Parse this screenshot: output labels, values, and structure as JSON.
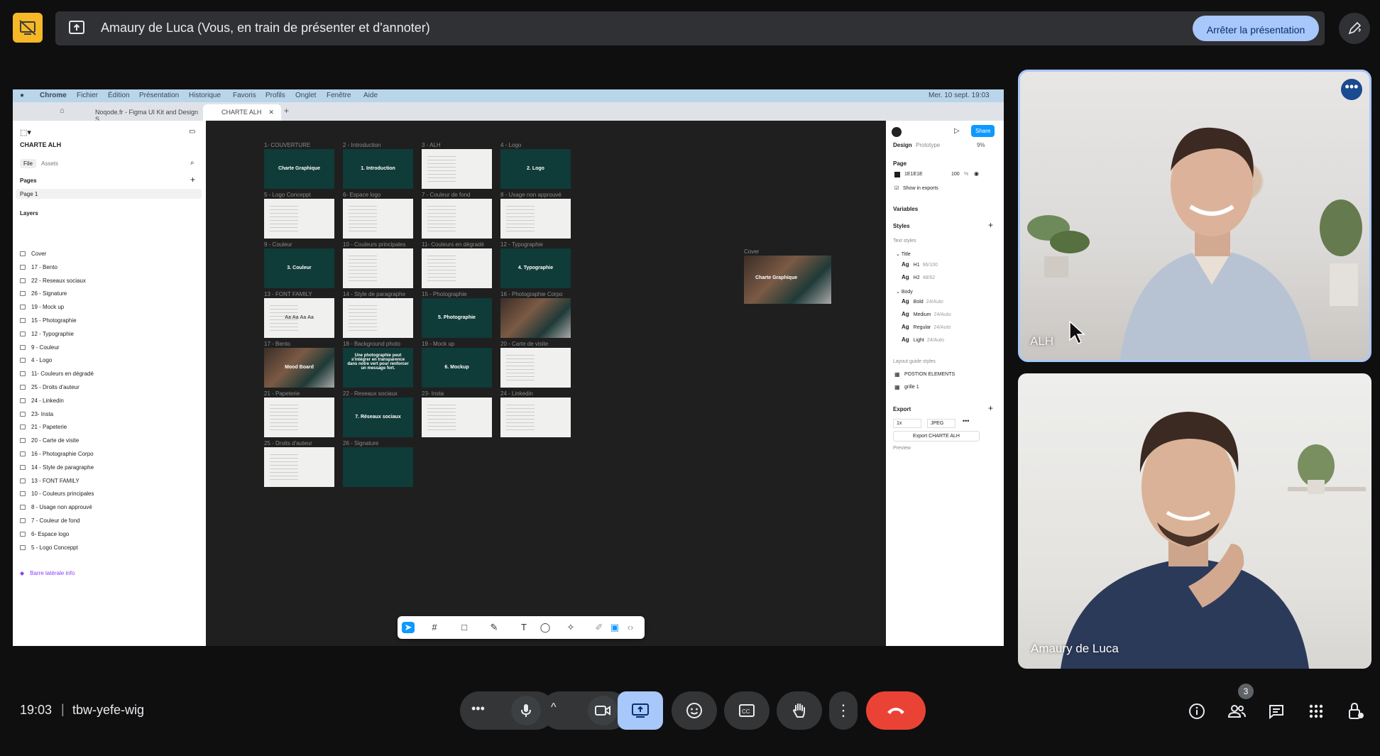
{
  "topbar": {
    "presenting_text": "Amaury de Luca (Vous, en train de présenter et d'annoter)",
    "stop_label": "Arrêter la présentation"
  },
  "shared_screen": {
    "mac_menu": [
      "Chrome",
      "Fichier",
      "Édition",
      "Présentation",
      "Historique",
      "Favoris",
      "Profils",
      "Onglet",
      "Fenêtre",
      "Aide"
    ],
    "mac_clock": "Mer. 10 sept. 19:03",
    "tabs": [
      "Noqode.fr - Figma UI Kit and Design S",
      "CHARTE ALH"
    ],
    "figma": {
      "file_name": "CHARTE ALH",
      "left_tabs": [
        "File",
        "Assets"
      ],
      "pages_label": "Pages",
      "page_1": "Page 1",
      "layers_label": "Layers",
      "layers": [
        "Cover",
        "17 - Bento",
        "22 - Reseaux sociaux",
        "26 - Signature",
        "19 - Mock up",
        "15 - Photographie",
        "12 - Typographie",
        "9 - Couleur",
        "4 - Logo",
        "11- Couleurs en dégradé",
        "25 - Droits d'auteur",
        "24 - Linkedin",
        "23- Insta",
        "21 - Papeterie",
        "20 - Carte de visite",
        "16 - Photographie Corpo",
        "14 - Style de paragraphe",
        "13 - FONT FAMILY",
        "10 - Couleurs principales",
        "8 - Usage  non approuvé",
        "7 - Couleur de fond",
        "6- Espace logo",
        "5 - Logo Conceppt"
      ],
      "last_layer": "Barre latérale info",
      "frames": [
        {
          "label": "1- COUVERTURE",
          "text": "Charte Graphique",
          "style": "dark"
        },
        {
          "label": "2 - Introduction",
          "text": "1. Introduction",
          "style": "dark"
        },
        {
          "label": "3 - ALH",
          "text": "",
          "style": "white"
        },
        {
          "label": "4 - Logo",
          "text": "2. Logo",
          "style": "dark"
        },
        {
          "label": "5 - Logo Conceppt",
          "text": "",
          "style": "white"
        },
        {
          "label": "6- Espace logo",
          "text": "",
          "style": "white"
        },
        {
          "label": "7 - Couleur de fond",
          "text": "",
          "style": "white"
        },
        {
          "label": "8 - Usage  non approuvé",
          "text": "",
          "style": "white"
        },
        {
          "label": "9 - Couleur",
          "text": "3. Couleur",
          "style": "dark"
        },
        {
          "label": "10 - Couleurs principales",
          "text": "",
          "style": "white"
        },
        {
          "label": "11- Couleurs en dégradé",
          "text": "",
          "style": "white"
        },
        {
          "label": "12 - Typographie",
          "text": "4. Typographie",
          "style": "dark"
        },
        {
          "label": "13 - FONT FAMILY",
          "text": "Aa Aa Aa Aa",
          "style": "white"
        },
        {
          "label": "14 - Style de paragraphe",
          "text": "",
          "style": "white"
        },
        {
          "label": "15 - Photographie",
          "text": "5. Photographie",
          "style": "dark"
        },
        {
          "label": "16 - Photographie Corpo",
          "text": "",
          "style": "photo"
        },
        {
          "label": "17 - Bento",
          "text": "Mood Board",
          "style": "photo"
        },
        {
          "label": "18 - Background photo",
          "text": "Une photographie peut s'intégrer en transparence dans notre vert pour renforcer un message fort.",
          "style": "dark"
        },
        {
          "label": "19 - Mock up",
          "text": "6. Mockup",
          "style": "dark"
        },
        {
          "label": "20 - Carte de visite",
          "text": "",
          "style": "white"
        },
        {
          "label": "21 - Papeterie",
          "text": "",
          "style": "white"
        },
        {
          "label": "22 - Reseaux sociaux",
          "text": "7. Réseaux sociaux",
          "style": "dark"
        },
        {
          "label": "23- Insta",
          "text": "",
          "style": "white"
        },
        {
          "label": "24 - Linkedin",
          "text": "",
          "style": "white"
        },
        {
          "label": "25 - Droits d'auteur",
          "text": "",
          "style": "white"
        },
        {
          "label": "26 - Signature",
          "text": "",
          "style": "dark"
        }
      ],
      "cover_label": "Cover",
      "cover_text": "Charte Graphique",
      "right": {
        "share": "Share",
        "tabs": [
          "Design",
          "Prototype"
        ],
        "zoom": "9%",
        "page_label": "Page",
        "page_color": "1E1E1E",
        "page_opacity": "100",
        "percent": "%",
        "show_exports": "Show in exports",
        "variables": "Variables",
        "styles": "Styles",
        "text_styles": "Text styles",
        "title_group": "Title",
        "body_group": "Body",
        "styles_list": [
          {
            "ag": "Ag",
            "name": "H1",
            "meta": "96/100"
          },
          {
            "ag": "Ag",
            "name": "H2",
            "meta": "48/62"
          },
          {
            "ag": "Ag",
            "name": "Bold",
            "meta": "24/Auto"
          },
          {
            "ag": "Ag",
            "name": "Medium",
            "meta": "24/Auto"
          },
          {
            "ag": "Ag",
            "name": "Regular",
            "meta": "24/Auto"
          },
          {
            "ag": "Ag",
            "name": "Light",
            "meta": "24/Auto"
          }
        ],
        "layout_guide": "Layout guide styles",
        "guide_1": "POSTION ELEMENTS",
        "guide_2": "grille 1",
        "export": "Export",
        "export_scale": "1x",
        "export_format": "JPEG",
        "export_button": "Export CHARTE ALH",
        "preview": "Preview"
      }
    }
  },
  "tiles": [
    {
      "name": "ALH"
    },
    {
      "name": "Amaury de Luca"
    }
  ],
  "bottombar": {
    "time": "19:03",
    "separator": "|",
    "meeting_code": "tbw-yefe-wig",
    "people_count": "3"
  },
  "colors": {
    "accent": "#a8c7fa",
    "end_call": "#ea4335",
    "figma_green": "#0f3b38",
    "figma_blue": "#0d99ff"
  }
}
